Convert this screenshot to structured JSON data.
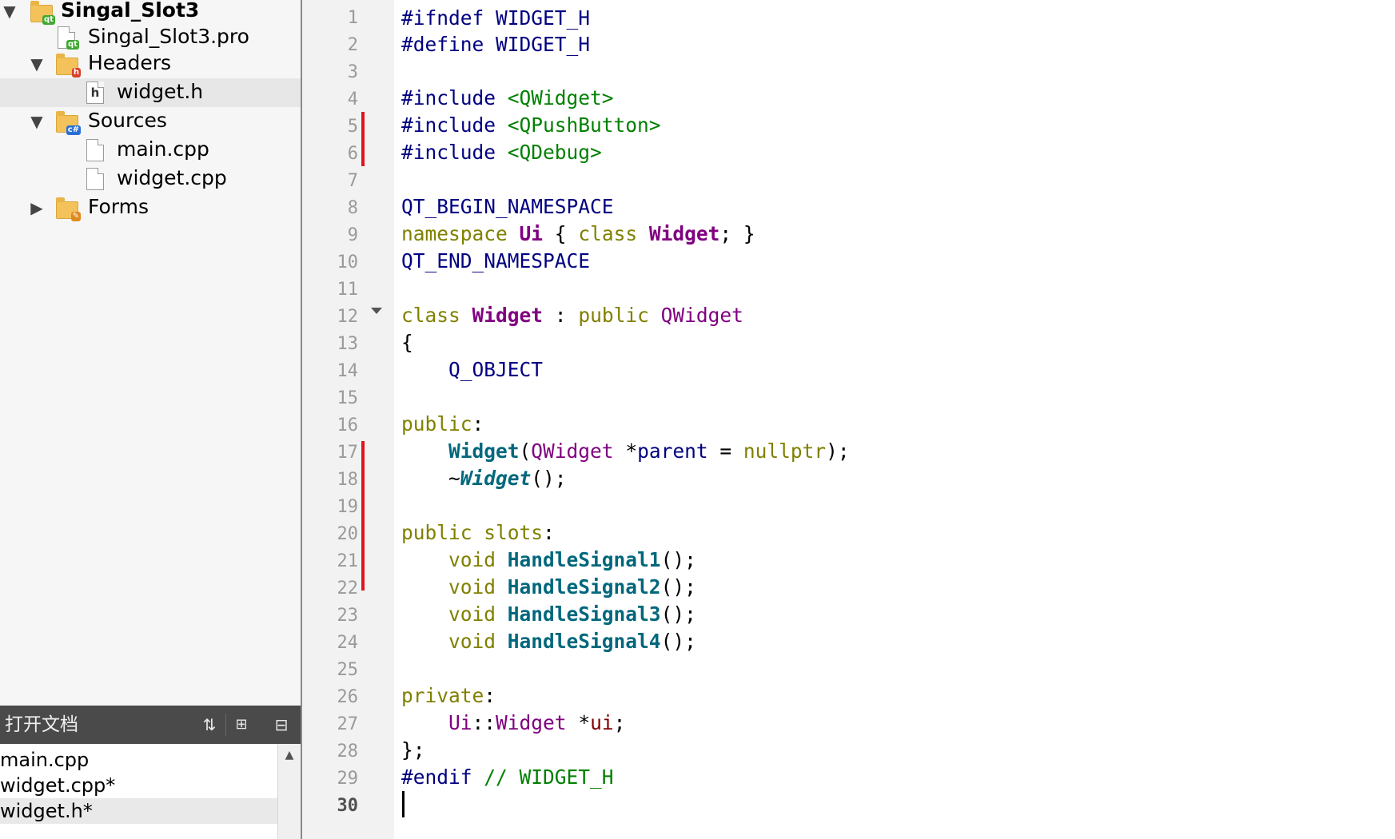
{
  "project_tree": {
    "project_name": "Singal_Slot3",
    "pro_file": "Singal_Slot3.pro",
    "headers_label": "Headers",
    "header_file": "widget.h",
    "sources_label": "Sources",
    "source_files": [
      "main.cpp",
      "widget.cpp"
    ],
    "forms_label": "Forms"
  },
  "open_documents": {
    "title": "打开文档",
    "files": [
      "main.cpp",
      "widget.cpp*",
      "widget.h*"
    ]
  },
  "editor": {
    "current_line": 30,
    "tokens": {
      "ifndef": "#ifndef",
      "define": "#define",
      "include": "#include",
      "endif": "#endif",
      "guard": "WIDGET_H",
      "inc_qwidget": "<QWidget>",
      "inc_qpushbutton": "<QPushButton>",
      "inc_qdebug": "<QDebug>",
      "qt_begin": "QT_BEGIN_NAMESPACE",
      "qt_end": "QT_END_NAMESPACE",
      "namespace": "namespace",
      "ui": "Ui",
      "class": "class",
      "widget": "Widget",
      "public": "public",
      "private": "private",
      "slots": "slots",
      "qwidget": "QWidget",
      "q_object": "Q_OBJECT",
      "parent": "parent",
      "nullptr": "nullptr",
      "void": "void",
      "handle1": "HandleSignal1",
      "handle2": "HandleSignal2",
      "handle3": "HandleSignal3",
      "handle4": "HandleSignal4",
      "ui_member": "ui",
      "comment": "// WIDGET_H"
    }
  }
}
